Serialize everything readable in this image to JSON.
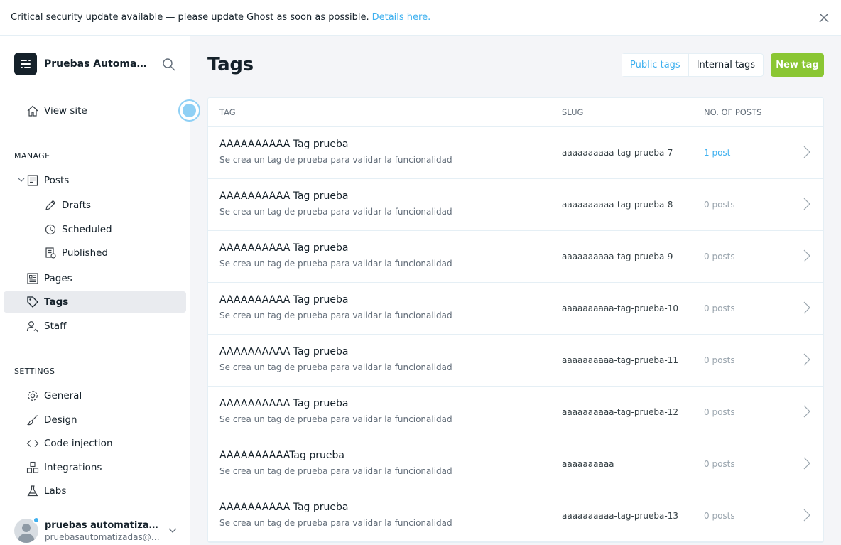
{
  "alert": {
    "message": "Critical security update available — please update Ghost as soon as possible.",
    "link_text": "Details here."
  },
  "brand": {
    "name": "Pruebas Automatizadas"
  },
  "sidebar": {
    "view_site": "View site",
    "manage_heading": "MANAGE",
    "posts": "Posts",
    "drafts": "Drafts",
    "scheduled": "Scheduled",
    "published": "Published",
    "pages": "Pages",
    "tags": "Tags",
    "staff": "Staff",
    "settings_heading": "SETTINGS",
    "general": "General",
    "design": "Design",
    "code_injection": "Code injection",
    "integrations": "Integrations",
    "labs": "Labs"
  },
  "user": {
    "name": "pruebas automatizadas",
    "email": "pruebasautomatizadas@uniandes.edu.co"
  },
  "page": {
    "title": "Tags",
    "public_tags": "Public tags",
    "internal_tags": "Internal tags",
    "new_tag": "New tag"
  },
  "table": {
    "headers": {
      "tag": "TAG",
      "slug": "SLUG",
      "posts": "NO. OF POSTS"
    },
    "rows": [
      {
        "name": "AAAAAAAAAA Tag prueba",
        "description": "Se crea un tag de prueba para validar la funcionalidad",
        "slug": "aaaaaaaaaa-tag-prueba-7",
        "posts": "1 post"
      },
      {
        "name": "AAAAAAAAAA Tag prueba",
        "description": "Se crea un tag de prueba para validar la funcionalidad",
        "slug": "aaaaaaaaaa-tag-prueba-8",
        "posts": "0 posts"
      },
      {
        "name": "AAAAAAAAAA Tag prueba",
        "description": "Se crea un tag de prueba para validar la funcionalidad",
        "slug": "aaaaaaaaaa-tag-prueba-9",
        "posts": "0 posts"
      },
      {
        "name": "AAAAAAAAAA Tag prueba",
        "description": "Se crea un tag de prueba para validar la funcionalidad",
        "slug": "aaaaaaaaaa-tag-prueba-10",
        "posts": "0 posts"
      },
      {
        "name": "AAAAAAAAAA Tag prueba",
        "description": "Se crea un tag de prueba para validar la funcionalidad",
        "slug": "aaaaaaaaaa-tag-prueba-11",
        "posts": "0 posts"
      },
      {
        "name": "AAAAAAAAAA Tag prueba",
        "description": "Se crea un tag de prueba para validar la funcionalidad",
        "slug": "aaaaaaaaaa-tag-prueba-12",
        "posts": "0 posts"
      },
      {
        "name": "AAAAAAAAAATag prueba",
        "description": "Se crea un tag de prueba para validar la funcionalidad",
        "slug": "aaaaaaaaaa",
        "posts": "0 posts"
      },
      {
        "name": "AAAAAAAAAA Tag prueba",
        "description": "Se crea un tag de prueba para validar la funcionalidad",
        "slug": "aaaaaaaaaa-tag-prueba-13",
        "posts": "0 posts"
      }
    ]
  },
  "colors": {
    "accent_blue": "#3eb0ef",
    "new_tag_green": "#8ac633",
    "active_nav_bg": "#e9ebef",
    "page_bg": "#f4f5f8"
  },
  "icons": [
    "close-icon",
    "ghost-logo-icon",
    "search-icon",
    "home-icon",
    "posts-icon",
    "pencil-icon",
    "clock-icon",
    "published-icon",
    "pages-icon",
    "tag-icon",
    "staff-icon",
    "gear-icon",
    "brush-icon",
    "code-icon",
    "integrations-icon",
    "flask-icon",
    "chevron-right-icon",
    "chevron-down-icon"
  ]
}
